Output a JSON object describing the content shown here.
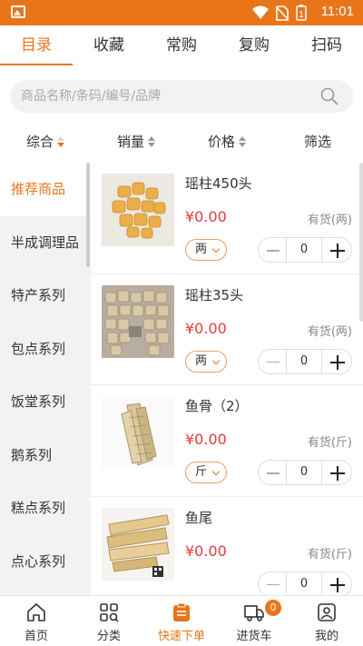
{
  "status_bar": {
    "time": "11:01",
    "battery_label": "1"
  },
  "top_tabs": [
    {
      "label": "目录",
      "active": true
    },
    {
      "label": "收藏"
    },
    {
      "label": "常购"
    },
    {
      "label": "复购"
    },
    {
      "label": "扫码"
    }
  ],
  "search": {
    "placeholder": "商品名称/条码/编号/品牌",
    "value": ""
  },
  "sort_bar": [
    {
      "label": "综合",
      "sortable": true,
      "active": true
    },
    {
      "label": "销量",
      "sortable": true
    },
    {
      "label": "价格",
      "sortable": true
    },
    {
      "label": "筛选",
      "sortable": false
    }
  ],
  "sidebar": {
    "items": [
      {
        "label": "推荐商品",
        "active": true
      },
      {
        "label": "半成调理品"
      },
      {
        "label": "特产系列"
      },
      {
        "label": "包点系列"
      },
      {
        "label": "饭堂系列"
      },
      {
        "label": "鹅系列"
      },
      {
        "label": "糕点系列"
      },
      {
        "label": "点心系列"
      }
    ]
  },
  "products": [
    {
      "name": "瑶柱450头",
      "price": "¥0.00",
      "stock": "有货(两)",
      "unit": "两",
      "qty": "0",
      "image": "scallop-yellow"
    },
    {
      "name": "瑶柱35头",
      "price": "¥0.00",
      "stock": "有货(两)",
      "unit": "两",
      "qty": "0",
      "image": "scallop-box"
    },
    {
      "name": "鱼骨（2）",
      "price": "¥0.00",
      "stock": "有货(斤)",
      "unit": "斤",
      "qty": "0",
      "image": "fish-bone"
    },
    {
      "name": "鱼尾",
      "price": "¥0.00",
      "stock": "有货(斤)",
      "unit": "",
      "qty": "0",
      "image": "fish-tail"
    }
  ],
  "bottom_nav": [
    {
      "label": "首页",
      "icon": "home-icon"
    },
    {
      "label": "分类",
      "icon": "category-icon"
    },
    {
      "label": "快速下单",
      "icon": "quick-order-icon",
      "active": true
    },
    {
      "label": "进货车",
      "icon": "cart-truck-icon",
      "badge": "0"
    },
    {
      "label": "我的",
      "icon": "profile-icon"
    }
  ],
  "colors": {
    "accent": "#e8751a",
    "price": "#e23c3c"
  }
}
